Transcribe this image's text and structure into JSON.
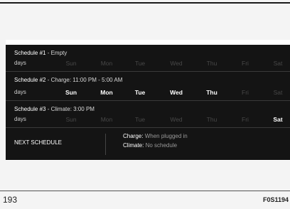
{
  "schedules": [
    {
      "name": "Schedule #1",
      "detail": " - Empty",
      "days_label": "days",
      "days": [
        {
          "label": "Sun",
          "active": false
        },
        {
          "label": "Mon",
          "active": false
        },
        {
          "label": "Tue",
          "active": false
        },
        {
          "label": "Wed",
          "active": false
        },
        {
          "label": "Thu",
          "active": false
        },
        {
          "label": "Fri",
          "active": false
        },
        {
          "label": "Sat",
          "active": false
        }
      ]
    },
    {
      "name": "Schedule #2",
      "detail": " - Charge: 11:00 PM - 5:00 AM",
      "days_label": "days",
      "days": [
        {
          "label": "Sun",
          "active": true
        },
        {
          "label": "Mon",
          "active": true
        },
        {
          "label": "Tue",
          "active": true
        },
        {
          "label": "Wed",
          "active": true
        },
        {
          "label": "Thu",
          "active": true
        },
        {
          "label": "Fri",
          "active": false
        },
        {
          "label": "Sat",
          "active": false
        }
      ]
    },
    {
      "name": "Schedule #3",
      "detail": " - Climate: 3:00 PM",
      "days_label": "days",
      "days": [
        {
          "label": "Sun",
          "active": false
        },
        {
          "label": "Mon",
          "active": false
        },
        {
          "label": "Tue",
          "active": false
        },
        {
          "label": "Wed",
          "active": false
        },
        {
          "label": "Thu",
          "active": false
        },
        {
          "label": "Fri",
          "active": false
        },
        {
          "label": "Sat",
          "active": true
        }
      ]
    }
  ],
  "next_schedule": {
    "label": "NEXT SCHEDULE",
    "charge_label": "Charge:",
    "charge_value": " When plugged in",
    "climate_label": "Climate:",
    "climate_value": " No schedule"
  },
  "page_number": "193",
  "figure_id": "F0S1194",
  "colors": {
    "screen_bg": "#141414",
    "active_day": "#ffffff",
    "inactive_day": "#484848"
  }
}
